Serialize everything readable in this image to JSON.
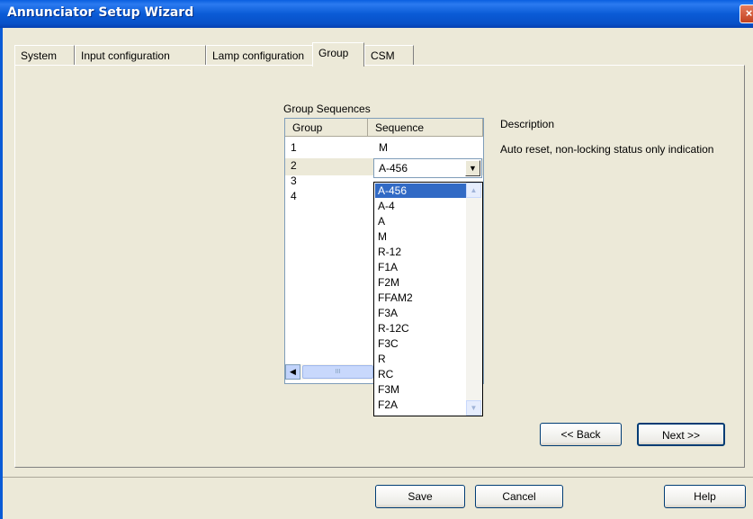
{
  "window": {
    "title": "Annunciator Setup Wizard",
    "close_symbol": "×"
  },
  "tabs": [
    {
      "label": "System"
    },
    {
      "label": "Input configuration"
    },
    {
      "label": "Lamp configuration"
    },
    {
      "label": "Group"
    },
    {
      "label": "CSM"
    }
  ],
  "active_tab": "Group",
  "group_sequences": {
    "label": "Group Sequences",
    "columns": [
      "Group",
      "Sequence"
    ],
    "rows": [
      {
        "group": "1",
        "sequence": "M"
      },
      {
        "group": "2",
        "sequence": "A-456"
      },
      {
        "group": "3",
        "sequence": ""
      },
      {
        "group": "4",
        "sequence": ""
      }
    ]
  },
  "sequence_combo": {
    "value": "A-456",
    "options": [
      "A-456",
      "A-4",
      "A",
      "M",
      "R-12",
      "F1A",
      "F2M",
      "FFAM2",
      "F3A",
      "R-12C",
      "F3C",
      "R",
      "RC",
      "F3M",
      "F2A"
    ],
    "selected_index": 0
  },
  "description": {
    "title": "Description",
    "text": "Auto reset, non-locking status only indication"
  },
  "nav_buttons": {
    "back": "<< Back",
    "next": "Next >>"
  },
  "footer_buttons": {
    "save": "Save",
    "cancel": "Cancel",
    "help": "Help"
  },
  "icons": {
    "dropdown_arrow": "▼",
    "scroll_left": "◀",
    "scroll_up": "▲",
    "scroll_down": "▼",
    "grip": "III"
  },
  "colors": {
    "selection": "#316AC5",
    "titlebar": "#0A5BD6",
    "face": "#ECE9D8"
  }
}
